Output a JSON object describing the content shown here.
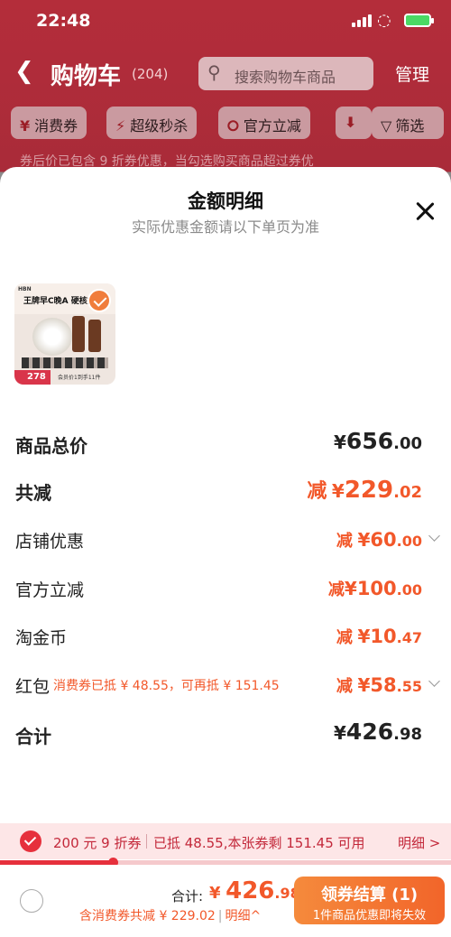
{
  "status": {
    "time": "22:48"
  },
  "header": {
    "title": "购物车",
    "count": "(204)",
    "search_placeholder": "搜索购物车商品",
    "manage": "管理"
  },
  "filters": [
    "消费券",
    "超级秒杀",
    "官方立减",
    "筛选"
  ],
  "banner": "券后价已包含 9 折券优惠，当勾选购买商品超过券优",
  "sheet": {
    "title": "金额明细",
    "subtitle": "实际优惠金额请以下单页为准",
    "product": {
      "brand": "HBN",
      "headline": "王牌早C晚A 硬核抗",
      "price_tag": "278",
      "footer": "会员价1到手11件"
    },
    "rows": {
      "total": {
        "label": "商品总价",
        "cur": "¥",
        "int": "656",
        "dec": ".00"
      },
      "reduce": {
        "label": "共减",
        "minus": "减",
        "cur": "¥",
        "int": "229",
        "dec": ".02"
      },
      "shop": {
        "label": "店铺优惠",
        "minus": "减",
        "cur": "¥",
        "int": "60",
        "dec": ".00"
      },
      "official": {
        "label": "官方立减",
        "minus": "减",
        "cur": "¥",
        "int": "100",
        "dec": ".00"
      },
      "coins": {
        "label": "淘金币",
        "minus": "减",
        "cur": "¥",
        "int": "10",
        "dec": ".47"
      },
      "hongbao": {
        "label": "红包",
        "note": "消费券已抵 ¥ 48.55，可再抵 ¥ 151.45",
        "minus": "减",
        "cur": "¥",
        "int": "58",
        "dec": ".55"
      },
      "sum": {
        "label": "合计",
        "cur": "¥",
        "int": "426",
        "dec": ".98"
      }
    }
  },
  "coupon": {
    "name": "200 元 9 折券",
    "desc": "已抵 48.55,本张券剩 151.45 可用",
    "link": "明细 >",
    "progress": 0.25
  },
  "footer": {
    "total_label": "合计:",
    "cur": "¥",
    "int": "426",
    "dec": ".98",
    "saved": "含消费券共减 ¥ 229.02",
    "detail": "明细^",
    "checkout": "领券结算 (1)",
    "checkout_sub": "1件商品优惠即将失效"
  },
  "colors": {
    "accent": "#f2582a",
    "red": "#e6303c",
    "header_bg": "#b42d3a"
  }
}
